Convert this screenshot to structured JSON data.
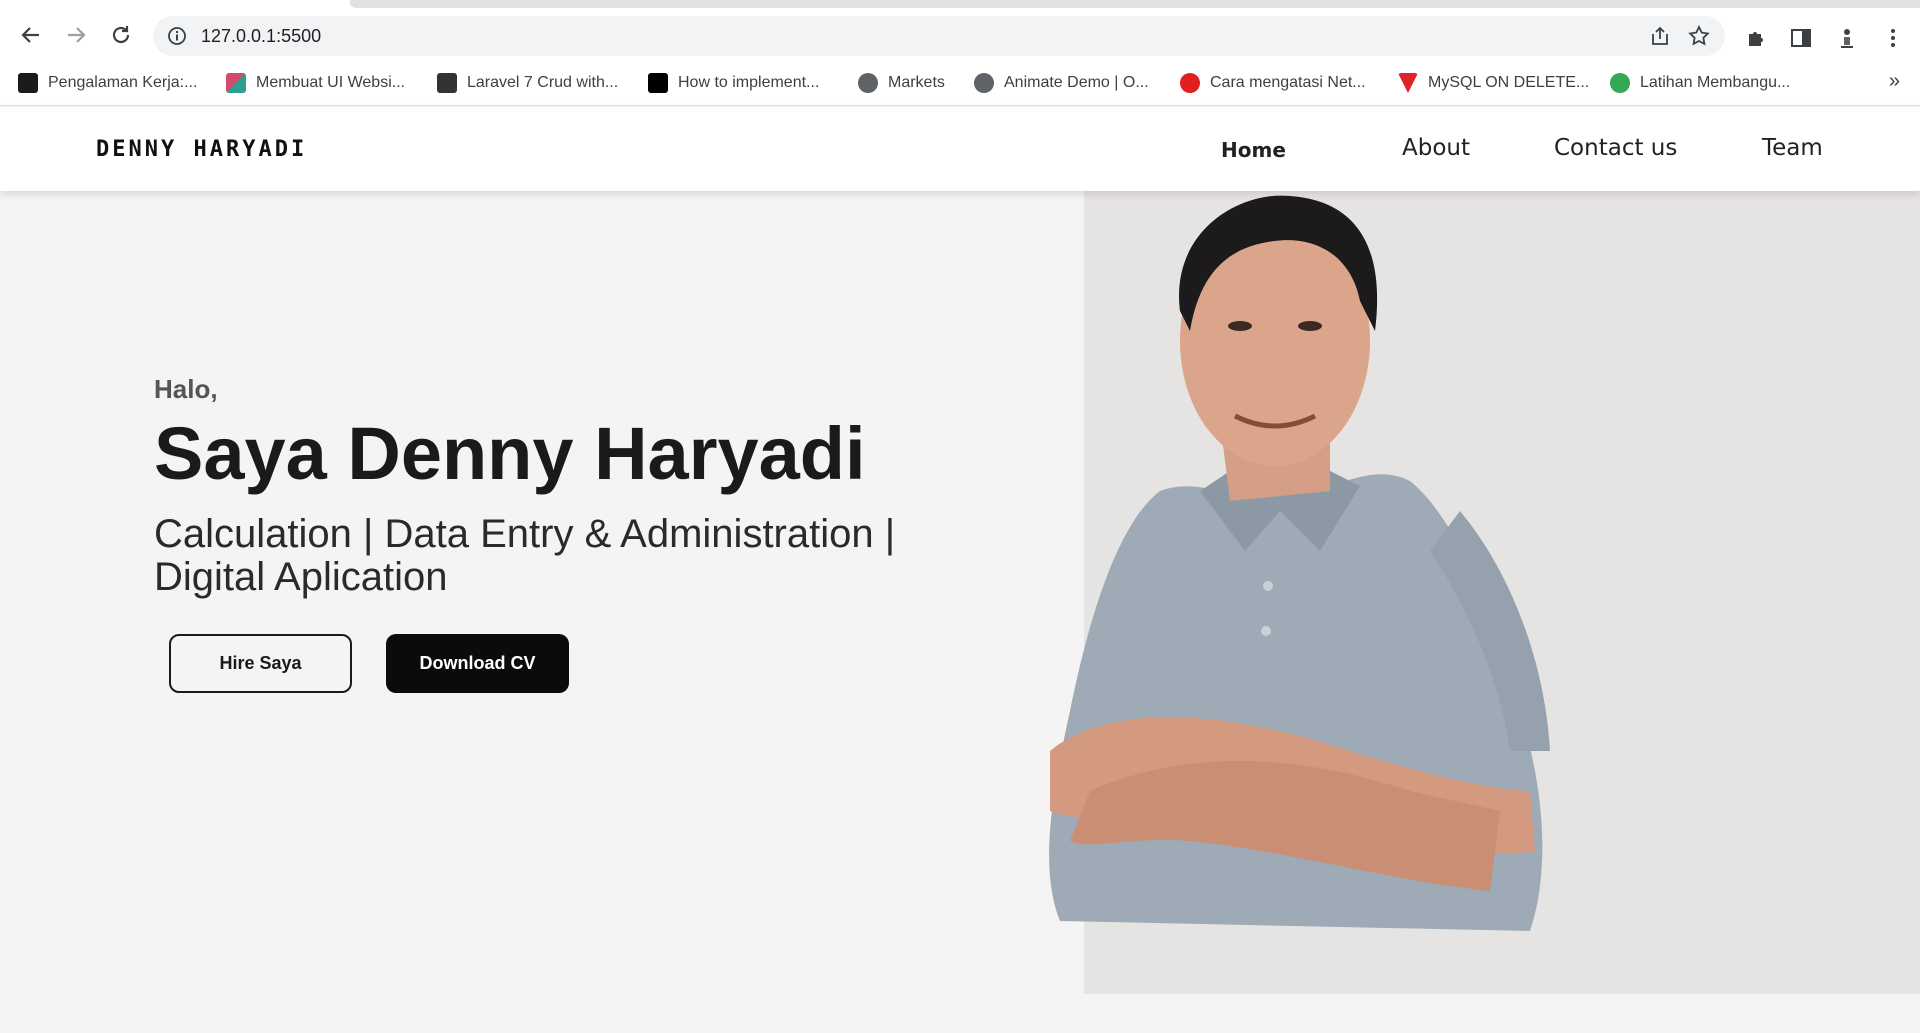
{
  "browser": {
    "url": "127.0.0.1:5500",
    "bookmarks": [
      {
        "label": "Pengalaman Kerja:...",
        "icon": "video-icon",
        "color": "#1a1a1a"
      },
      {
        "label": "Membuat UI Websi...",
        "icon": "cube-icon",
        "color": "#d44a6a"
      },
      {
        "label": "Laravel 7 Crud with...",
        "icon": "tm-icon",
        "color": "#333333"
      },
      {
        "label": "How to implement...",
        "icon": "dev-icon",
        "color": "#000000"
      },
      {
        "label": "Markets",
        "icon": "globe-icon",
        "color": "#5f6368"
      },
      {
        "label": "Animate Demo | O...",
        "icon": "globe-icon",
        "color": "#5f6368"
      },
      {
        "label": "Cara mengatasi Net...",
        "icon": "red-circle-icon",
        "color": "#e02020"
      },
      {
        "label": "MySQL ON DELETE...",
        "icon": "v-shield-icon",
        "color": "#e0202a"
      },
      {
        "label": "Latihan Membangu...",
        "icon": "leaf-icon",
        "color": "#34a853"
      }
    ],
    "more_label": "»"
  },
  "site": {
    "logo": "DENNY HARYADI",
    "menu": [
      {
        "label": "Home",
        "active": true
      },
      {
        "label": "About",
        "active": false
      },
      {
        "label": "Contact us",
        "active": false
      },
      {
        "label": "Team",
        "active": false
      }
    ]
  },
  "hero": {
    "greeting": "Halo,",
    "headline": "Saya Denny Haryadi",
    "tagline": "Calculation | Data Entry & Administration | Digital Aplication",
    "buttons": {
      "hire": "Hire Saya",
      "download": "Download CV"
    }
  }
}
